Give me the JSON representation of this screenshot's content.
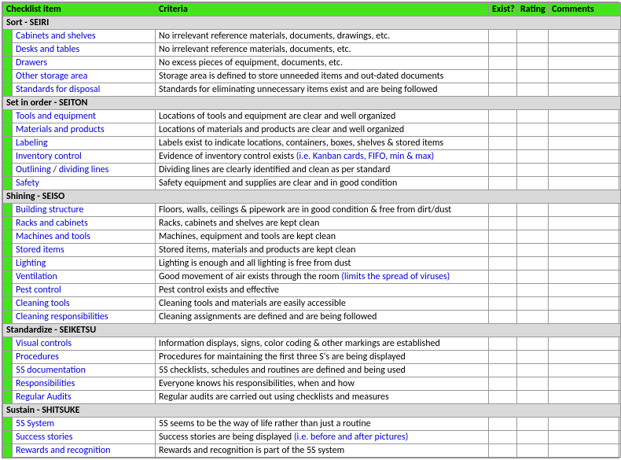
{
  "headers": {
    "item": "Checklist item",
    "criteria": "Criteria",
    "exist": "Exist?",
    "rating": "Rating",
    "comments": "Comments"
  },
  "sections": [
    {
      "title": "Sort - SEIRI",
      "rows": [
        {
          "item": "Cabinets and shelves",
          "criteria": "No irrelevant reference materials, documents, drawings, etc."
        },
        {
          "item": "Desks and tables",
          "criteria": "No irrelevant reference materials, documents, etc."
        },
        {
          "item": "Drawers",
          "criteria": "No excess pieces of equipment, documents, etc."
        },
        {
          "item": "Other storage area",
          "criteria": "Storage area is defined to store unneeded items and out-dated documents"
        },
        {
          "item": "Standards for disposal",
          "criteria": "Standards for eliminating unnecessary items exist and are being followed"
        }
      ]
    },
    {
      "title": "Set in order - SEITON",
      "rows": [
        {
          "item": "Tools and equipment",
          "criteria": "Locations of tools and equipment are clear and well organized"
        },
        {
          "item": "Materials and products",
          "criteria": "Locations of materials and products are clear and well organized"
        },
        {
          "item": "Labeling",
          "criteria": "Labels exist to indicate locations, containers, boxes, shelves & stored items"
        },
        {
          "item": "Inventory control",
          "criteria": "Evidence of inventory control exists ",
          "note": "(i.e. Kanban cards, FIFO, min & max)"
        },
        {
          "item": "Outlining / dividing lines",
          "criteria": "Dividing lines are clearly identified and clean as per standard"
        },
        {
          "item": "Safety",
          "criteria": "Safety equipment and supplies are clear and in good condition"
        }
      ]
    },
    {
      "title": "Shining - SEISO",
      "rows": [
        {
          "item": "Building structure",
          "criteria": "Floors, walls, ceilings & pipework are in good condition & free from dirt/dust"
        },
        {
          "item": "Racks and cabinets",
          "criteria": "Racks, cabinets and shelves are kept clean"
        },
        {
          "item": "Machines and tools",
          "criteria": "Machines, equipment and tools are kept clean"
        },
        {
          "item": "Stored items",
          "criteria": "Stored items, materials and products are kept clean"
        },
        {
          "item": "Lighting",
          "criteria": "Lighting is enough and all lighting is free from dust"
        },
        {
          "item": "Ventilation",
          "criteria": "Good movement of air exists through the room ",
          "note": "(limits the spread of viruses)"
        },
        {
          "item": "Pest control",
          "criteria": "Pest control exists and effective"
        },
        {
          "item": "Cleaning tools",
          "criteria": "Cleaning tools and materials are easily accessible"
        },
        {
          "item": "Cleaning responsibilities",
          "criteria": "Cleaning assignments are defined and are being followed"
        }
      ]
    },
    {
      "title": "Standardize - SEIKETSU",
      "rows": [
        {
          "item": "Visual controls",
          "criteria": "Information displays, signs, color coding & other markings are established"
        },
        {
          "item": "Procedures",
          "criteria": "Procedures for maintaining the first three S's are being displayed"
        },
        {
          "item": "5S documentation",
          "criteria": "5S checklists, schedules and routines are defined and being used"
        },
        {
          "item": "Responsibilities",
          "criteria": "Everyone knows his responsibilities, when and how"
        },
        {
          "item": "Regular Audits",
          "criteria": "Regular audits are carried out using checklists and measures"
        }
      ]
    },
    {
      "title": "Sustain - SHITSUKE",
      "rows": [
        {
          "item": "5S System",
          "criteria": "5S seems to be the way of life rather than just a routine"
        },
        {
          "item": "Success stories",
          "criteria": "Success stories are being displayed ",
          "note": "(i.e. before and after pictures)"
        },
        {
          "item": "Rewards and recognition",
          "criteria": "Rewards and recognition is part of the 5S system"
        }
      ]
    }
  ]
}
